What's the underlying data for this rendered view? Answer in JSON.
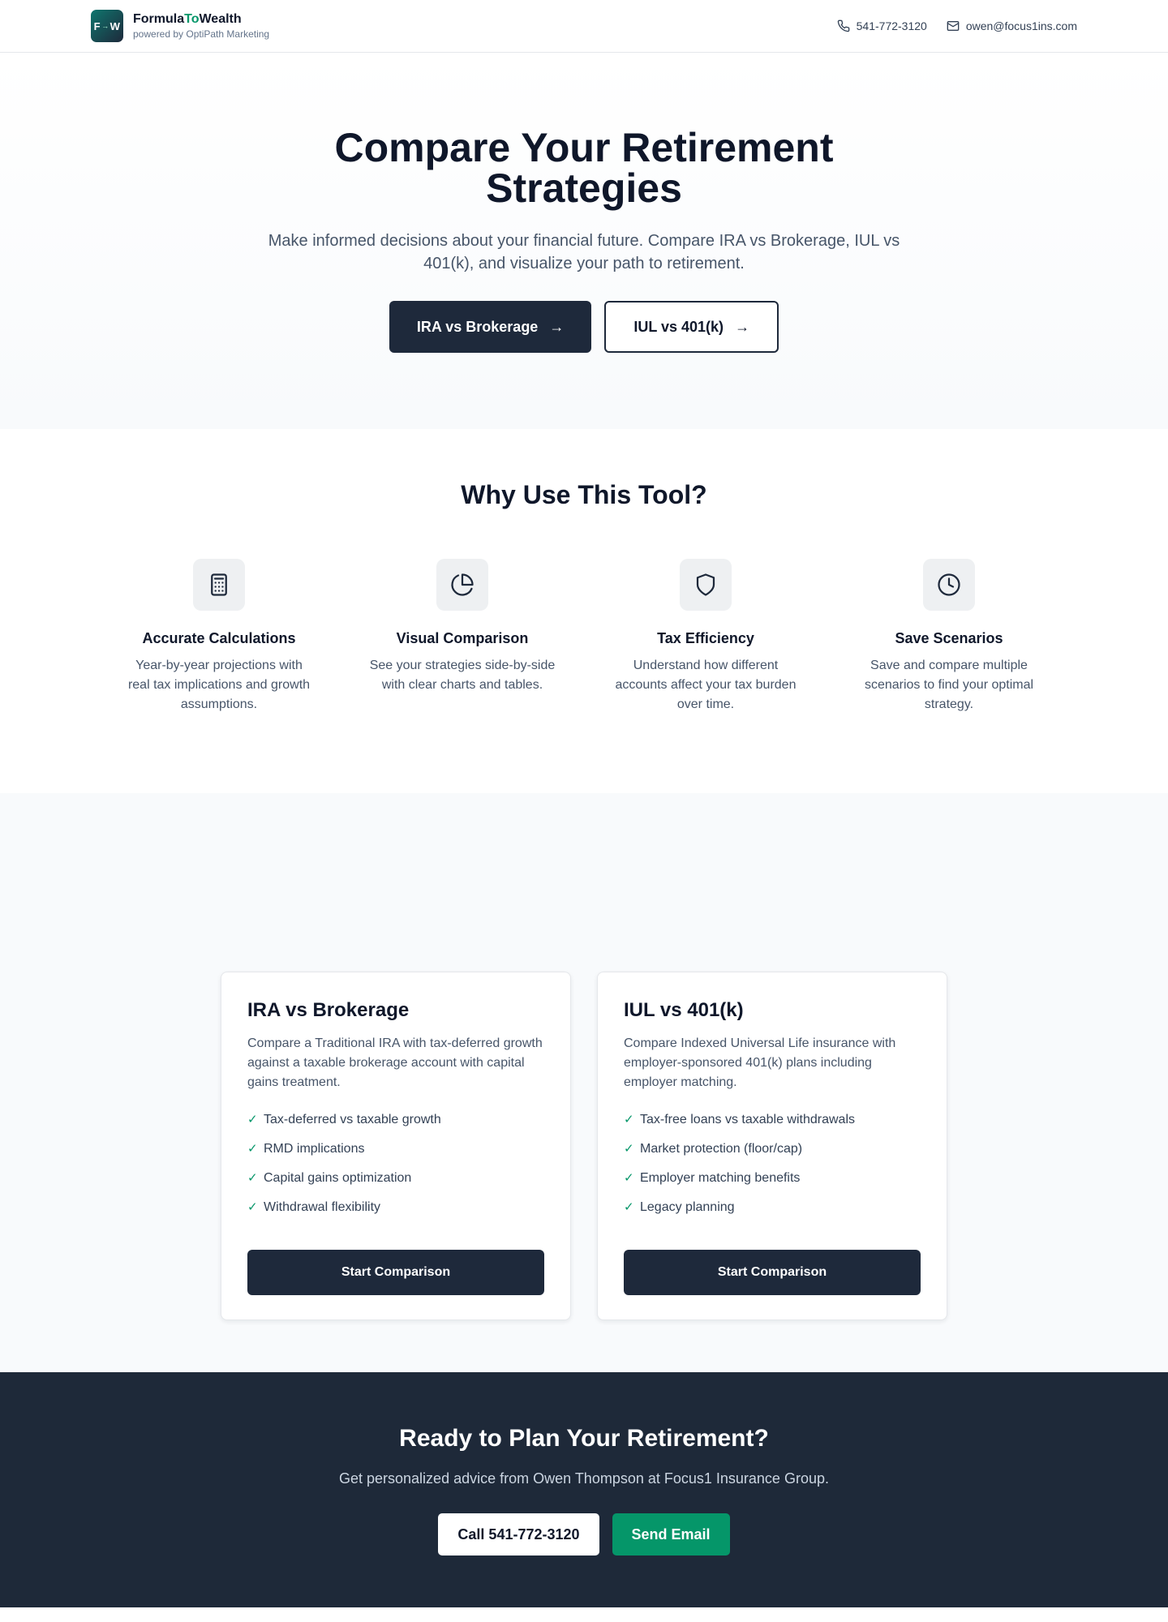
{
  "header": {
    "logo_text_left": "F",
    "logo_arrow": "→",
    "logo_text_right": "W",
    "brand_part1": "Formula",
    "brand_part2": "To",
    "brand_part3": "Wealth",
    "brand_sub": "powered by OptiPath Marketing",
    "phone": "541-772-3120",
    "email": "owen@focus1ins.com"
  },
  "hero": {
    "title": "Compare Your Retirement Strategies",
    "subtitle": "Make informed decisions about your financial future. Compare IRA vs Brokerage, IUL vs 401(k), and visualize your path to retirement.",
    "primary_button": "IRA vs Brokerage",
    "secondary_button": "IUL vs 401(k)"
  },
  "features": {
    "title": "Why Use This Tool?",
    "items": [
      {
        "icon": "calculator-icon",
        "title": "Accurate Calculations",
        "text": "Year-by-year projections with real tax implications and growth assumptions."
      },
      {
        "icon": "pie-chart-icon",
        "title": "Visual Comparison",
        "text": "See your strategies side-by-side with clear charts and tables."
      },
      {
        "icon": "shield-icon",
        "title": "Tax Efficiency",
        "text": "Understand how different accounts affect your tax burden over time."
      },
      {
        "icon": "clock-icon",
        "title": "Save Scenarios",
        "text": "Save and compare multiple scenarios to find your optimal strategy."
      }
    ]
  },
  "cards": [
    {
      "title": "IRA vs Brokerage",
      "description": "Compare a Traditional IRA with tax-deferred growth against a taxable brokerage account with capital gains treatment.",
      "bullets": [
        "Tax-deferred vs taxable growth",
        "RMD implications",
        "Capital gains optimization",
        "Withdrawal flexibility"
      ],
      "button": "Start Comparison"
    },
    {
      "title": "IUL vs 401(k)",
      "description": "Compare Indexed Universal Life insurance with employer-sponsored 401(k) plans including employer matching.",
      "bullets": [
        "Tax-free loans vs taxable withdrawals",
        "Market protection (floor/cap)",
        "Employer matching benefits",
        "Legacy planning"
      ],
      "button": "Start Comparison"
    }
  ],
  "cta": {
    "title": "Ready to Plan Your Retirement?",
    "subtitle": "Get personalized advice from Owen Thompson at Focus1 Insurance Group.",
    "call_button": "Call 541-772-3120",
    "email_button": "Send Email"
  },
  "colors": {
    "primary_dark": "#1e293b",
    "accent_green": "#059669",
    "cta_background": "#1e2939"
  }
}
